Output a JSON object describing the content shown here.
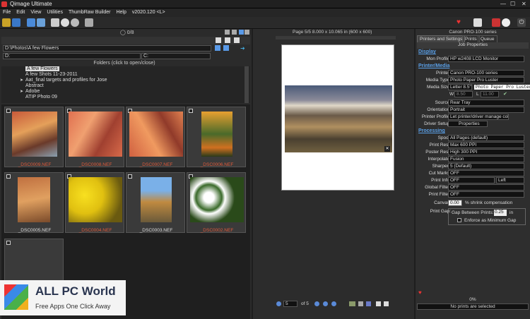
{
  "window": {
    "title": "Qimage Ultimate"
  },
  "menu": [
    "File",
    "Edit",
    "View",
    "Utilities",
    "ThumbRaw Builder",
    "Help",
    "v2020.120 <L>"
  ],
  "left": {
    "count": "0/8",
    "path": "D:\\Photos\\A few Flowers",
    "drive": "D:",
    "drive2": "C:",
    "folders_label": "Folders (click to open/close)",
    "folders": [
      "A few Flowers",
      "A few Shots 11-23-2011",
      "Aat_final targets and profiles for Jose",
      "Abstract",
      "Adobe",
      "ATIP Photo 09"
    ],
    "thumbs": [
      {
        "name": "_DSC0009.NEF",
        "color": "#e05a3a"
      },
      {
        "name": "_DSC0008.NEF",
        "color": "#e05a3a"
      },
      {
        "name": "_DSC0007.NEF",
        "color": "#e05a3a"
      },
      {
        "name": "_DSC0006.NEF",
        "color": "#e05a3a"
      },
      {
        "name": "_DSC0005.NEF",
        "color": "#dddddd"
      },
      {
        "name": "_DSC0004.NEF",
        "color": "#e05a3a"
      },
      {
        "name": "_DSC0003.NEF",
        "color": "#dddddd"
      },
      {
        "name": "_DSC0002.NEF",
        "color": "#e05a3a"
      }
    ]
  },
  "mid": {
    "page_info": "Page 5/5  8.000 x 10.065 in   (600 x 600)",
    "page_num": "5",
    "page_of": "of 5"
  },
  "right": {
    "printer": "Canon PRO-100 series",
    "tabs": [
      "Printers and Settings",
      "Prints",
      "Queue"
    ],
    "job_props": "Job Properties",
    "display_header": "Display",
    "mon_profile_label": "Mon Profile:",
    "mon_profile": "HP w2408 LCD Monitor",
    "printmedia_header": "Printer/Media",
    "printer_label": "Printer:",
    "printer_val": "Canon PRO-100 series",
    "media_type_label": "Media Type:",
    "media_type": "Photo Paper Pro Luster",
    "media_size_label": "Media Size:",
    "media_size": "Letter 8.5\"x1",
    "tooltip": "Photo Paper Pro Luster",
    "w_label": "W",
    "w_val": "8.50",
    "l_label": "L",
    "l_val": "11.00",
    "source_label": "Source:",
    "source": "Rear Tray",
    "orient_label": "Orientation:",
    "orient": "Portrait",
    "pprofile_label": "Printer Profile:",
    "pprofile": "Let printer/driver manage color",
    "dsetup_label": "Driver Setup:",
    "dsetup": "Properties",
    "processing_header": "Processing",
    "spool_label": "Spool:",
    "spool": "All Pages (default)",
    "pres_label": "Print Res.:",
    "pres": "Max 600 PPI",
    "posres_label": "Poster Res.:",
    "posres": "High 300 PPI",
    "interp_label": "Interpolate:",
    "interp": "Fusion",
    "sharpen_label": "Sharpen:",
    "sharpen": "5 (Default)",
    "cutmarks_label": "Cut Marks:",
    "cutmarks": "OFF",
    "pinfo_label": "Print Info:",
    "pinfo": "OFF",
    "pinfo2": "Left",
    "gfilter_label": "Global Filter:",
    "gfilter": "OFF",
    "pfilter_label": "Print Filter:",
    "pfilter": "OFF",
    "canvas_label": "Canvas:",
    "canvas_val": "0.00",
    "canvas_text": "% shrink compensation",
    "gap_label": "Print Gap:",
    "gap_text": "Gap Between Prints:",
    "gap_val": "0.25",
    "gap_unit": "in",
    "enforce": "Enforce as Minimum Gap",
    "progress": "0%",
    "status": "No prints are selected"
  },
  "watermark": {
    "title": "ALL PC World",
    "subtitle": "Free Apps One Click Away"
  }
}
